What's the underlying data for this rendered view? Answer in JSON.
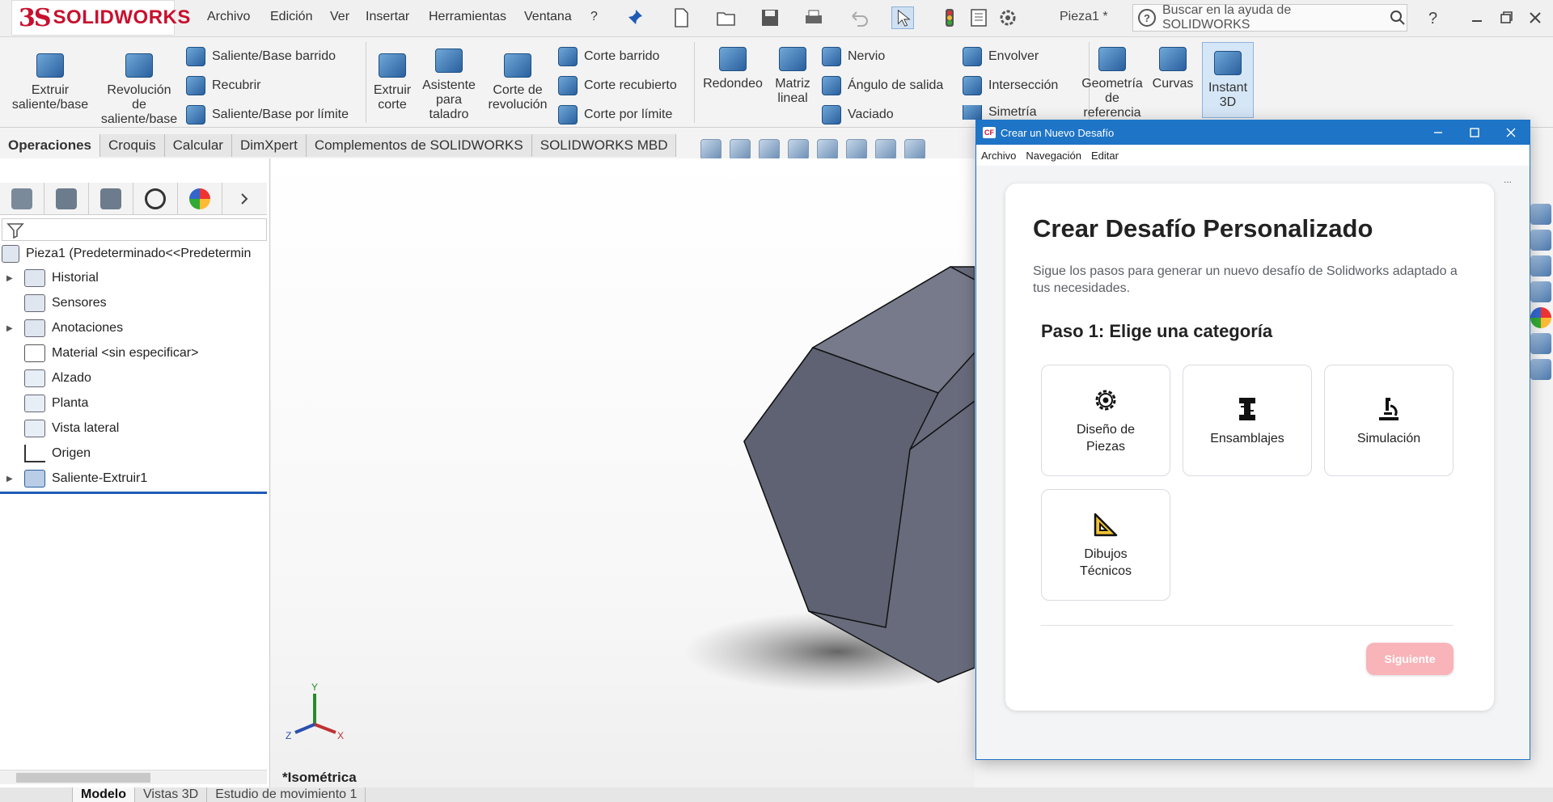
{
  "app": {
    "logo_ds": "3S",
    "logo_text": "SOLIDWORKS"
  },
  "menu": [
    "Archivo",
    "Edición",
    "Ver",
    "Insertar",
    "Herramientas",
    "Ventana",
    "?"
  ],
  "doc_title": "Pieza1 *",
  "help_search": {
    "placeholder": "Buscar en la ayuda de SOLIDWORKS"
  },
  "ribbon": {
    "extruir_saliente": "Extruir\nsaliente/base",
    "revolucion_saliente": "Revolución\nde\nsaliente/base",
    "saliente_barrido": "Saliente/Base barrido",
    "recubrir": "Recubrir",
    "saliente_limite": "Saliente/Base por límite",
    "extruir_corte": "Extruir\ncorte",
    "asistente_taladro": "Asistente\npara\ntaladro",
    "corte_revolucion": "Corte de\nrevolución",
    "corte_barrido": "Corte barrido",
    "corte_recubierto": "Corte recubierto",
    "corte_limite": "Corte por límite",
    "redondeo": "Redondeo",
    "matriz_lineal": "Matriz\nlineal",
    "nervio": "Nervio",
    "angulo_salida": "Ángulo de salida",
    "vaciado": "Vaciado",
    "envolver": "Envolver",
    "interseccion": "Intersección",
    "simetria": "Simetría",
    "geometria_referencia": "Geometría\nde\nreferencia",
    "curvas": "Curvas",
    "instant3d": "Instant\n3D"
  },
  "tabs": [
    "Operaciones",
    "Croquis",
    "Calcular",
    "DimXpert",
    "Complementos de SOLIDWORKS",
    "SOLIDWORKS MBD"
  ],
  "tree": {
    "root": "Pieza1  (Predeterminado<<Predetermin",
    "items": [
      "Historial",
      "Sensores",
      "Anotaciones",
      "Material <sin especificar>",
      "Alzado",
      "Planta",
      "Vista lateral",
      "Origen",
      "Saliente-Extruir1"
    ]
  },
  "viewport": {
    "view_name": "*Isométrica",
    "axis_x": "X",
    "axis_y": "Y",
    "axis_z": "Z"
  },
  "bottom_tabs": [
    "Modelo",
    "Vistas 3D",
    "Estudio de movimiento 1"
  ],
  "dialog": {
    "title": "Crear un Nuevo Desafío",
    "menu": [
      "Archivo",
      "Navegación",
      "Editar"
    ],
    "heading": "Crear Desafío Personalizado",
    "subtitle": "Sigue los pasos para generar un nuevo desafío de Solidworks adaptado a tus necesidades.",
    "step_title": "Paso 1: Elige una categoría",
    "categories": [
      {
        "label": "Diseño de Piezas",
        "icon": "gear-icon"
      },
      {
        "label": "Ensamblajes",
        "icon": "assembly-icon"
      },
      {
        "label": "Simulación",
        "icon": "microscope-icon"
      },
      {
        "label": "Dibujos Técnicos",
        "icon": "set-square-icon"
      }
    ],
    "next_label": "Siguiente",
    "dots": "..."
  },
  "colors": {
    "accent": "#1e74c6",
    "brand": "#c8102e",
    "next_button": "#f8b4b9"
  }
}
